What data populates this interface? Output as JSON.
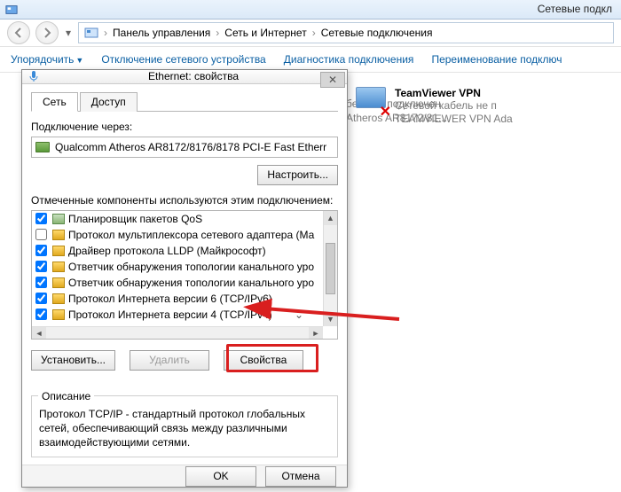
{
  "window": {
    "title": "Сетевые подкл"
  },
  "addressbar": {
    "seg1": "Панель управления",
    "seg2": "Сеть и Интернет",
    "seg3": "Сетевые подключения"
  },
  "toolbar": {
    "organize": "Упорядочить",
    "disable": "Отключение сетевого устройства",
    "diagnose": "Диагностика подключения",
    "rename": "Переименование подключ"
  },
  "cutoff": {
    "l1": "бель не подключен",
    "l2": "Atheros AR8172/81..."
  },
  "netitem": {
    "name": "TeamViewer VPN",
    "status": "Сетевой кабель не п",
    "adapter": "TEAMVIEWER VPN Ada"
  },
  "dialog": {
    "title": "Ethernet: свойства",
    "tabs": {
      "network": "Сеть",
      "access": "Доступ"
    },
    "connect_via": "Подключение через:",
    "adapter": "Qualcomm Atheros AR8172/8176/8178 PCI-E Fast Etherr",
    "configure": "Настроить...",
    "components_label": "Отмеченные компоненты используются этим подключением:",
    "components": [
      {
        "checked": true,
        "icon": "svc",
        "label": "Планировщик пакетов QoS"
      },
      {
        "checked": false,
        "icon": "net",
        "label": "Протокол мультиплексора сетевого адаптера (Ма"
      },
      {
        "checked": true,
        "icon": "net",
        "label": "Драйвер протокола LLDP (Майкрософт)"
      },
      {
        "checked": true,
        "icon": "net",
        "label": "Ответчик обнаружения топологии канального уро"
      },
      {
        "checked": true,
        "icon": "net",
        "label": "Ответчик обнаружения топологии канального уро"
      },
      {
        "checked": true,
        "icon": "net",
        "label": "Протокол Интернета версии 6 (TCP/IPv6)"
      },
      {
        "checked": true,
        "icon": "net",
        "label": "Протокол Интернета версии 4 (TCP/IPv4)"
      }
    ],
    "install": "Установить...",
    "uninstall": "Удалить",
    "properties": "Свойства",
    "desc_label": "Описание",
    "desc_text": "Протокол TCP/IP - стандартный протокол глобальных сетей, обеспечивающий связь между различными взаимодействующими сетями.",
    "ok": "OK",
    "cancel": "Отмена"
  }
}
